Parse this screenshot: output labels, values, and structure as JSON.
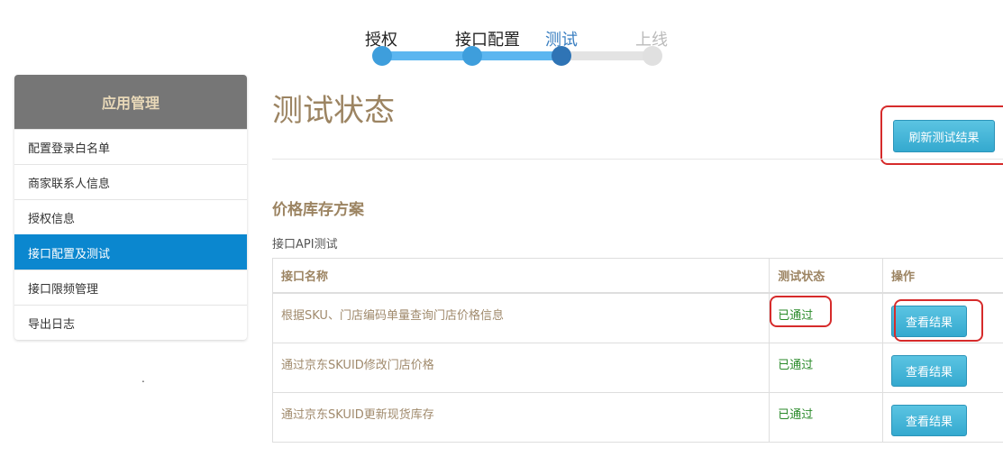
{
  "steps": [
    {
      "label": "授权",
      "state": "done"
    },
    {
      "label": "接口配置",
      "state": "done"
    },
    {
      "label": "测试",
      "state": "active"
    },
    {
      "label": "上线",
      "state": "todo"
    }
  ],
  "sidebar": {
    "title": "应用管理",
    "items": [
      {
        "label": "配置登录白名单"
      },
      {
        "label": "商家联系人信息"
      },
      {
        "label": "授权信息"
      },
      {
        "label": "接口配置及测试",
        "active": true
      },
      {
        "label": "接口限频管理"
      },
      {
        "label": "导出日志"
      }
    ],
    "stray_mark": "."
  },
  "main": {
    "title": "测试状态",
    "refresh_label": "刷新测试结果",
    "section_title": "价格库存方案",
    "sub_title": "接口API测试",
    "table": {
      "headers": [
        "接口名称",
        "测试状态",
        "操作"
      ],
      "rows": [
        {
          "name": "根据SKU、门店编码单量查询门店价格信息",
          "status": "已通过",
          "action": "查看结果"
        },
        {
          "name": "通过京东SKUID修改门店价格",
          "status": "已通过",
          "action": "查看结果"
        },
        {
          "name": "通过京东SKUID更新现货库存",
          "status": "已通过",
          "action": "查看结果"
        }
      ]
    }
  },
  "colors": {
    "accent_blue": "#0b87cf",
    "title_brown": "#9c8462",
    "pass_green": "#2a8a2a",
    "highlight_red": "#d62b2b"
  }
}
